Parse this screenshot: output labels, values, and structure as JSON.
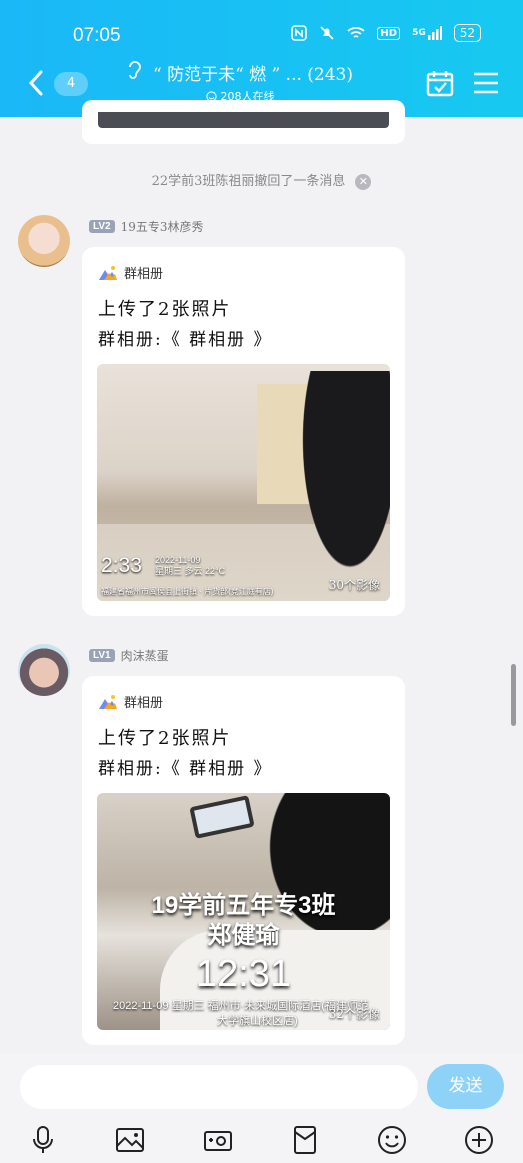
{
  "status_bar": {
    "time": "07:05",
    "network": "5G",
    "hd": "HD",
    "battery": "52"
  },
  "header": {
    "unread_count": "4",
    "title": "“ 防范于未“ 燃 ” ... (243)",
    "online": "208人在线"
  },
  "system_notice": {
    "text": "22学前3班陈祖丽撤回了一条消息"
  },
  "messages": [
    {
      "level": "LV2",
      "sender": "19五专3林彦秀",
      "card_source": "群相册",
      "line1": "上传了2张照片",
      "line2": "群相册:《 群相册 》",
      "photo_time": "2:33",
      "photo_date": "2022-11-09",
      "photo_weather": "星期三  多云 22°C",
      "photo_address": "福建省福州市闽侯县上街镇 · 片货部(竞江庭有店)",
      "photo_count": "30个影像"
    },
    {
      "level": "LV1",
      "sender": "肉沫蒸蛋",
      "card_source": "群相册",
      "line1": "上传了2张照片",
      "line2": "群相册:《 群相册 》",
      "photo_banner_line1": "19学前五年专3班",
      "photo_banner_line2": "郑健瑜",
      "photo_time": "12:31",
      "photo_address_line1": "2022-11-09 星期三  福州市·未来城国际酒店(福建师范",
      "photo_address_line2": "大学旗山校区店)",
      "photo_count": "32个影像"
    }
  ],
  "composer": {
    "placeholder": "",
    "send_label": "发送"
  },
  "toolbar_icons": [
    "microphone-icon",
    "image-icon",
    "camera-icon",
    "red-packet-icon",
    "emoji-icon",
    "plus-icon"
  ],
  "colors": {
    "header": "#1ab8f7",
    "send_button": "#8fd2f8",
    "background": "#f2f2f4"
  }
}
